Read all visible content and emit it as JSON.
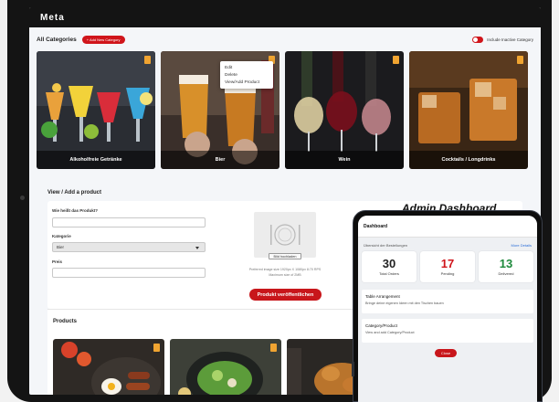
{
  "app": {
    "brand": "Meta"
  },
  "categories": {
    "title": "All Categories",
    "add_button": "+ Add New Category",
    "toggle_label": "Include Inactive Category",
    "items": [
      {
        "label": "Alkoholfreie Getränke"
      },
      {
        "label": "Bier"
      },
      {
        "label": "Wein"
      },
      {
        "label": "Cocktails / Longdrinks"
      }
    ]
  },
  "context_menu": {
    "items": [
      "Edit",
      "Delete",
      "View/Add Product"
    ]
  },
  "product_form": {
    "section_title": "View / Add a product",
    "name_label": "Wie heißt das Produkt?",
    "name_value": "",
    "category_label": "Kategorie",
    "category_value": "Bier",
    "price_label": "Preis",
    "price_value": "",
    "image_button": "Bild hochladen",
    "image_hint_1": "Preferred image size 1920px X 1080px 8:70 RPS",
    "image_hint_2": "Maximum size of 2MB",
    "publish_button": "Produkt veröffentlichen"
  },
  "admin_heading": "Admin Dashboard",
  "products": {
    "title": "Products"
  },
  "phone": {
    "title": "Dashboard",
    "subtitle": "Übersicht der Bestellungen",
    "more_link": "More Details",
    "stats": [
      {
        "value": "30",
        "label": "Total Orders",
        "color": "#222222"
      },
      {
        "value": "17",
        "label": "Pending",
        "color": "#d0151b"
      },
      {
        "value": "13",
        "label": "Delivered",
        "color": "#1e8a3c"
      }
    ],
    "cards": [
      {
        "title": "Table Arrangement",
        "text": "Bringe deine eigenen Ideen mit den Tischen bauen"
      },
      {
        "title": "Category/Product",
        "text": "View and add Category/Product"
      }
    ],
    "close_button": "Close"
  },
  "colors": {
    "accent": "#d0151b",
    "badge": "#f0a431",
    "dark": "#141414"
  }
}
